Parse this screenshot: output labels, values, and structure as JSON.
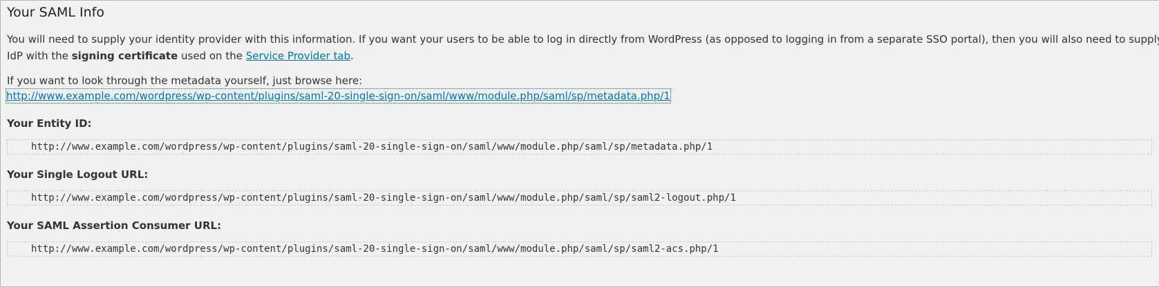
{
  "section": {
    "title": "Your SAML Info",
    "intro_text": "You will need to supply your identity provider with this information. If you want your users to be able to log in directly from WordPress (as opposed to logging in from a separate SSO portal), then you will also need to supply your",
    "intro_text_2a": "IdP with the ",
    "intro_bold": "signing certificate",
    "intro_text_2b": " used on the ",
    "intro_link": "Service Provider tab",
    "intro_text_2c": ".",
    "browse_text": "If you want to look through the metadata yourself, just browse here:",
    "metadata_url": "http://www.example.com/wordpress/wp-content/plugins/saml-20-single-sign-on/saml/www/module.php/saml/sp/metadata.php/1"
  },
  "fields": {
    "entity_id_label": "Your Entity ID:",
    "entity_id_value": "http://www.example.com/wordpress/wp-content/plugins/saml-20-single-sign-on/saml/www/module.php/saml/sp/metadata.php/1",
    "logout_label": "Your Single Logout URL:",
    "logout_value": "http://www.example.com/wordpress/wp-content/plugins/saml-20-single-sign-on/saml/www/module.php/saml/sp/saml2-logout.php/1",
    "acs_label": "Your SAML Assertion Consumer URL:",
    "acs_value": "http://www.example.com/wordpress/wp-content/plugins/saml-20-single-sign-on/saml/www/module.php/saml/sp/saml2-acs.php/1"
  },
  "colors": {
    "background": "#f1f1f1",
    "text": "#333333",
    "link": "#0073aa",
    "code_border": "#cccccc"
  }
}
